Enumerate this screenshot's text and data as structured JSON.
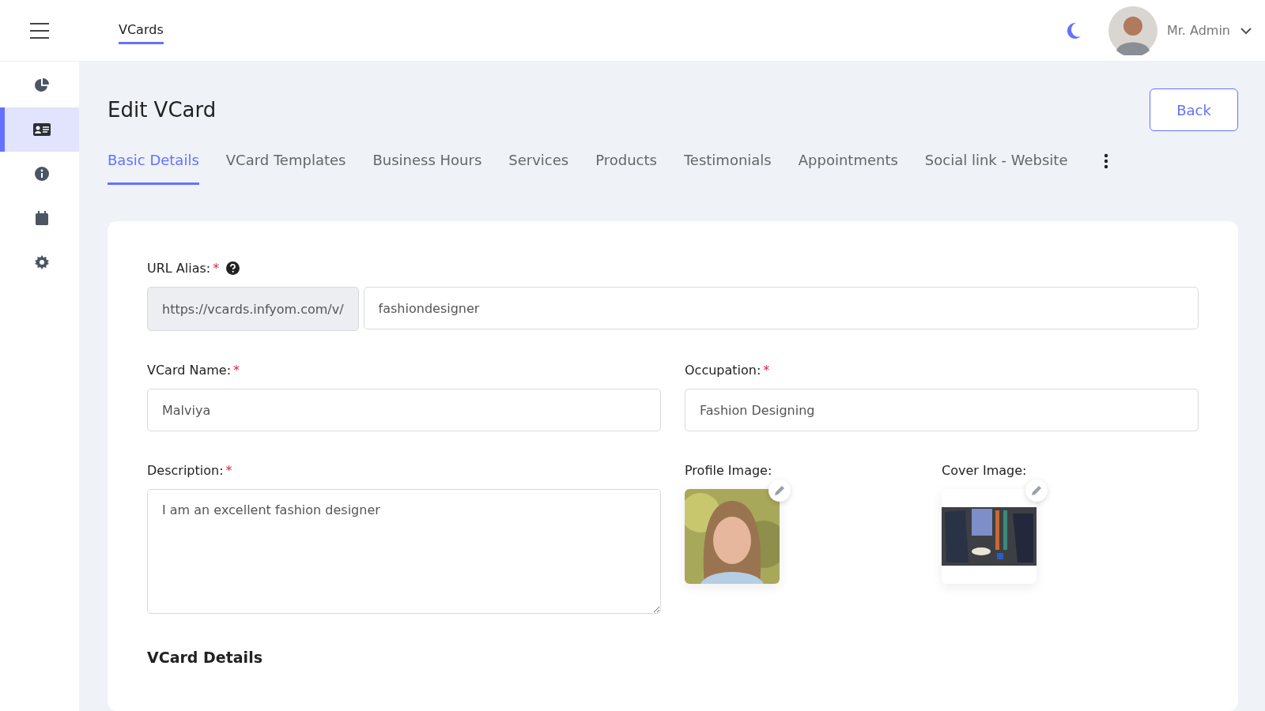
{
  "header": {
    "breadcrumb": "VCards",
    "user": {
      "name": "Mr. Admin"
    }
  },
  "sidebar": {
    "items": [
      {
        "kind": "dashboard",
        "selected": false
      },
      {
        "kind": "vcards",
        "selected": true
      },
      {
        "kind": "info",
        "selected": false
      },
      {
        "kind": "calendar",
        "selected": false
      },
      {
        "kind": "settings",
        "selected": false
      }
    ]
  },
  "page": {
    "title": "Edit VCard",
    "back_button": "Back"
  },
  "tabs": [
    {
      "label": "Basic Details",
      "selected": true
    },
    {
      "label": "VCard Templates",
      "selected": false
    },
    {
      "label": "Business Hours",
      "selected": false
    },
    {
      "label": "Services",
      "selected": false
    },
    {
      "label": "Products",
      "selected": false
    },
    {
      "label": "Testimonials",
      "selected": false
    },
    {
      "label": "Appointments",
      "selected": false
    },
    {
      "label": "Social link - Website",
      "selected": false
    }
  ],
  "form": {
    "url_alias": {
      "label": "URL Alias:",
      "required_mark": "*",
      "prefix": "https://vcards.infyom.com/v/",
      "value": "fashiondesigner"
    },
    "vcard_name": {
      "label": "VCard Name:",
      "required_mark": "*",
      "value": "Malviya"
    },
    "occupation": {
      "label": "Occupation:",
      "required_mark": "*",
      "value": "Fashion Designing"
    },
    "description": {
      "label": "Description:",
      "required_mark": "*",
      "value": "I am an excellent fashion designer"
    },
    "profile_image": {
      "label": "Profile Image:",
      "kind": "picture"
    },
    "cover_image": {
      "label": "Cover Image:",
      "kind": "picture"
    },
    "section_heading": "VCard Details"
  }
}
